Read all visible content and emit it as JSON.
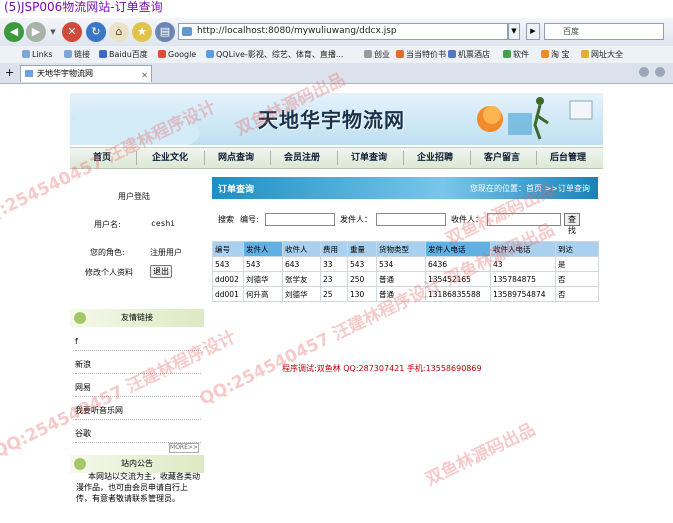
{
  "window": {
    "title": "(5)JSP006物流网站-订单查询"
  },
  "browser": {
    "address": "http://localhost:8080/mywuliuwang/ddcx.jsp",
    "search_placeholder": "百度",
    "bookmarks": [
      "Links",
      "链接",
      "Baidu百度",
      "Google",
      "QQLive-影视、综艺、体育、直播...",
      "创业",
      "当当特价书",
      "机票酒店",
      "软件",
      "淘 宝",
      "网址大全"
    ],
    "tab": {
      "label": "天地华宇物流网"
    }
  },
  "site": {
    "banner_title": "天地华宇物流网",
    "menu": [
      "首页",
      "企业文化",
      "网点查询",
      "会员注册",
      "订单查询",
      "企业招聘",
      "客户留言",
      "后台管理"
    ]
  },
  "sidebar": {
    "login_title": "用户登陆",
    "username_label": "用户名:",
    "username_value": "ceshi",
    "role_label": "您的角色:",
    "role_value": "注册用户",
    "modify_label": "修改个人资料",
    "logout_label": "退出",
    "links_title": "友情链接",
    "links": [
      "f",
      "新浪",
      "网易",
      "我要听音乐网",
      "谷歌"
    ],
    "more_label": "MORE>>",
    "notice_title": "站内公告",
    "notice_text": "本网站以交流为主，收藏各类动漫作品，也可由会员申请自行上传，有意者敬请联系管理员。"
  },
  "main": {
    "title": "订单查询",
    "location": "您现在的位置：首页 >>订单查询",
    "search": {
      "prefix": "搜索",
      "number_label": "编号:",
      "sender_label": "发件人：",
      "receiver_label": "收件人：",
      "button": "查找"
    },
    "table": {
      "headers": [
        "编号",
        "发件人",
        "收件人",
        "费用",
        "重量",
        "货物类型",
        "发件人电话",
        "收件人电话",
        "到达"
      ],
      "rows": [
        [
          "543",
          "543",
          "643",
          "33",
          "543",
          "534",
          "6436",
          "43",
          "是"
        ],
        [
          "dd002",
          "刘德华",
          "张学友",
          "23",
          "250",
          "普通",
          "135452165",
          "135784875",
          "否"
        ],
        [
          "dd001",
          "何升高",
          "刘德华",
          "25",
          "130",
          "普通",
          "13186835588",
          "13589754874",
          "否"
        ]
      ]
    },
    "footer": "程序调试:双鱼林  QQ:287307421  手机:13558690869"
  },
  "watermark": [
    "QQ:254540457 汪建林程序设计",
    "双鱼林源码出品",
    "QQ:254540457 汪建林程序设计 双鱼林源码出品"
  ]
}
